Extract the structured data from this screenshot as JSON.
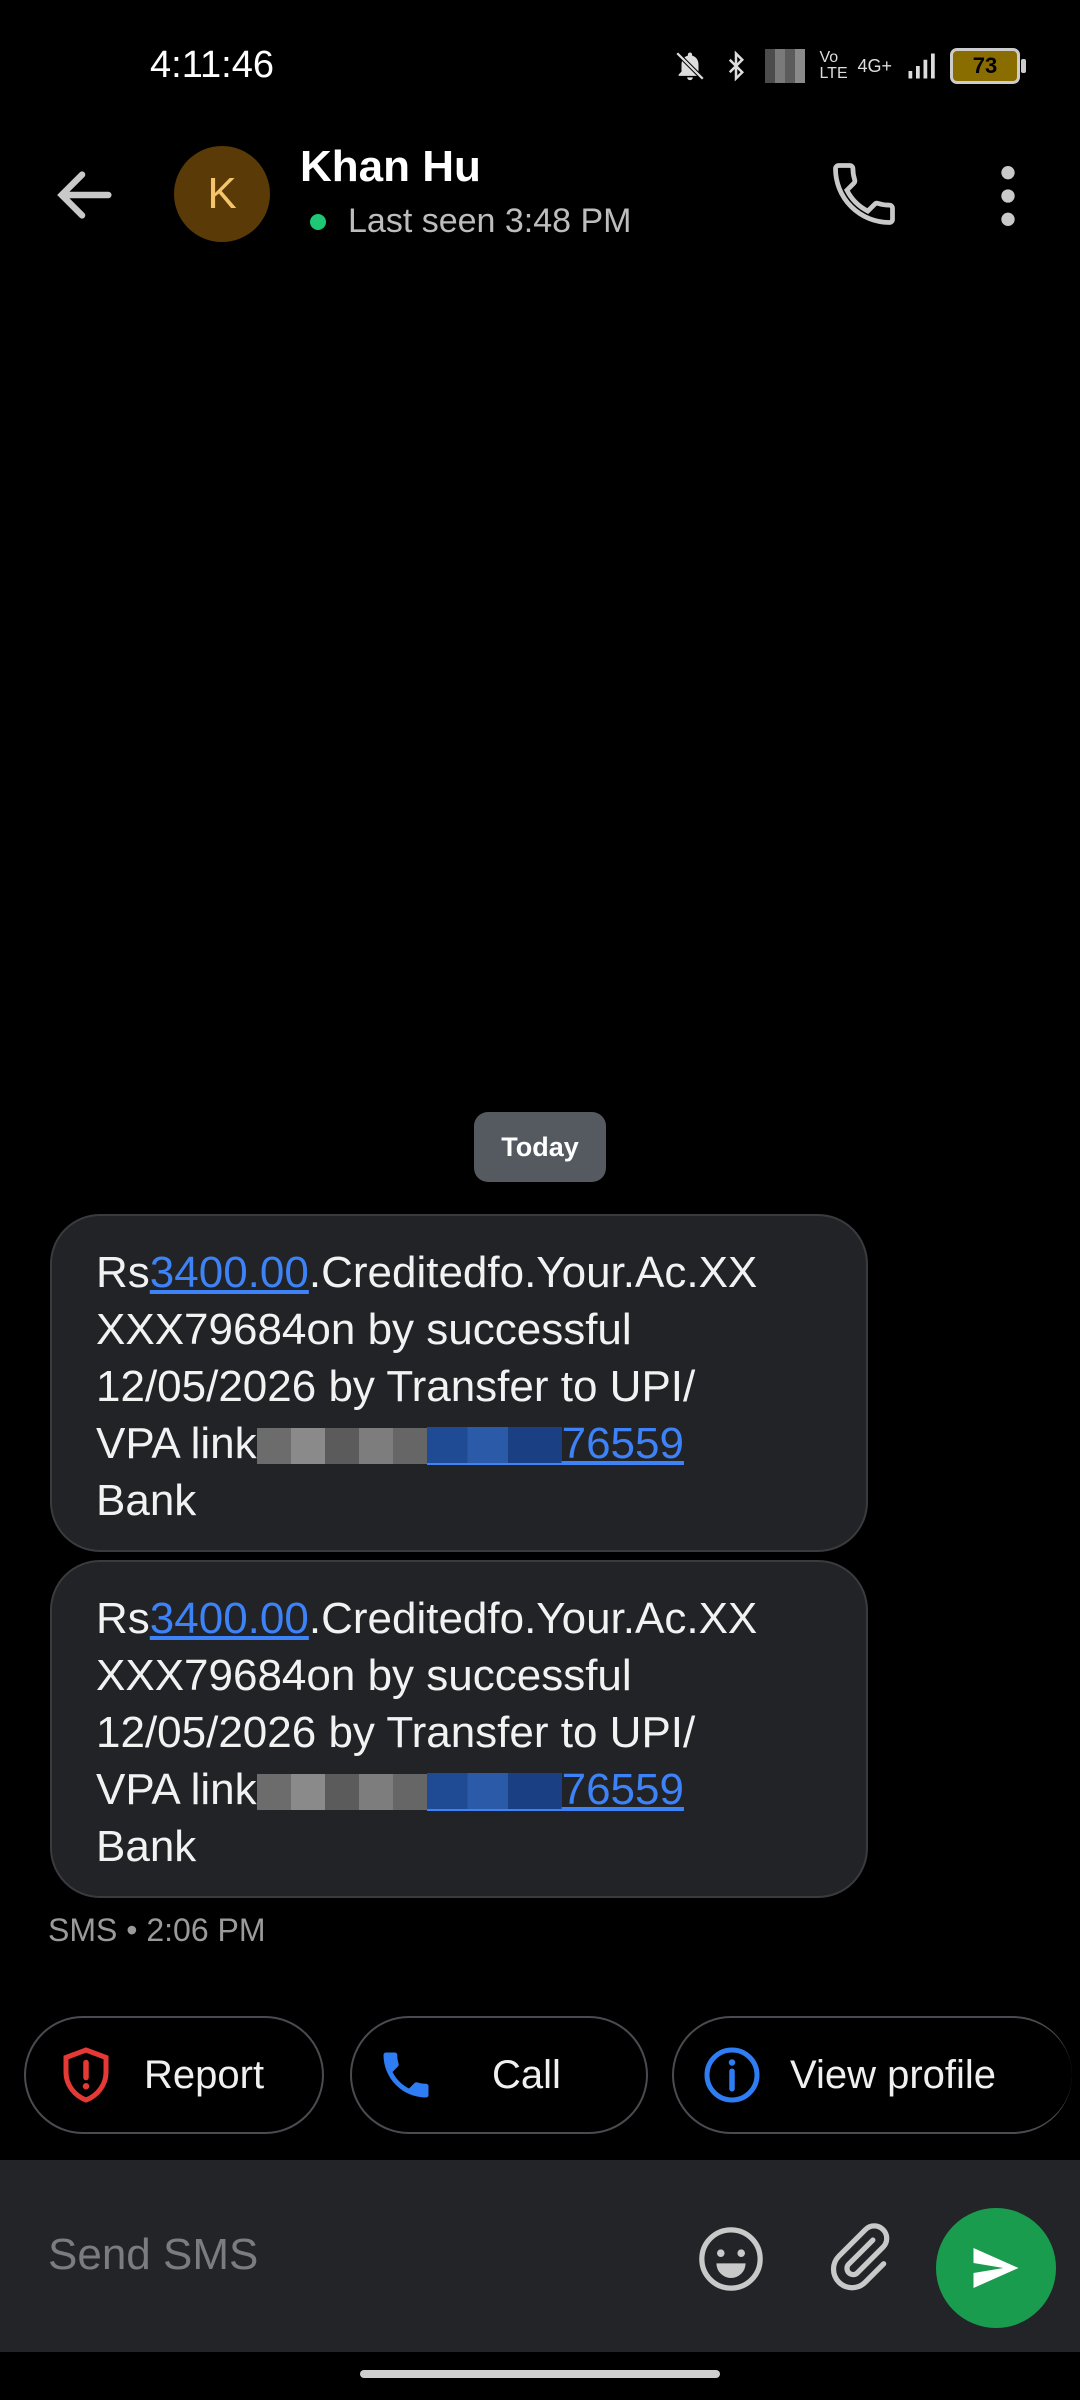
{
  "status_bar": {
    "time": "4:11:46",
    "battery": "73",
    "network_label": "4G+",
    "volte_label": "Vo LTE"
  },
  "header": {
    "contact_name": "Khan Hu",
    "avatar_initial": "K",
    "last_seen": "Last seen 3:48 PM"
  },
  "conversation": {
    "date_chip": "Today",
    "messages": [
      {
        "prefix": "Rs",
        "amount_link": "3400.00",
        "line1_rest": ".Creditedfo.Your.Ac.XX",
        "line2": "XXX79684on by successful",
        "line3": "12/05/2026 by Transfer to UPI/",
        "line4_start": "VPA link",
        "line4_link_end": "76559",
        "line5": "Bank"
      },
      {
        "prefix": "Rs",
        "amount_link": "3400.00",
        "line1_rest": ".Creditedfo.Your.Ac.XX",
        "line2": "XXX79684on by successful",
        "line3": "12/05/2026 by Transfer to UPI/",
        "line4_start": "VPA link",
        "line4_link_end": "76559",
        "line5": "Bank"
      }
    ],
    "meta": "SMS • 2:06 PM"
  },
  "actions": {
    "report": "Report",
    "call": "Call",
    "view_profile": "View profile"
  },
  "compose": {
    "placeholder": "Send SMS"
  },
  "colors": {
    "accent_link": "#3d82f6",
    "send_button": "#1a9c4f",
    "online": "#1ec773",
    "report_icon": "#e53935"
  }
}
